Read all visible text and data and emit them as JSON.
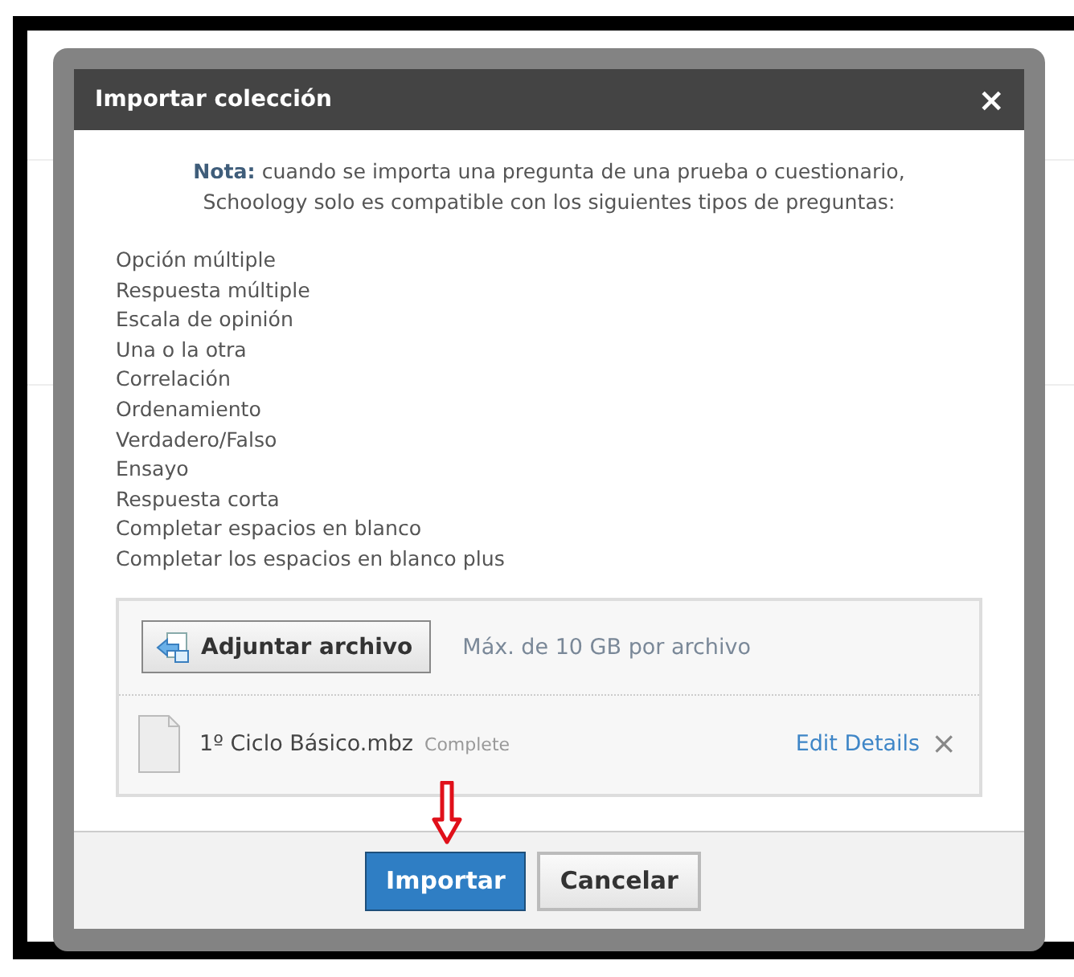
{
  "dialog": {
    "title": "Importar colección",
    "close": "×"
  },
  "note": "**Nota:** cuando se importa una pregunta de una prueba o cuestionario, Schoology solo es compatible con los siguientes tipos de preguntas:",
  "question_types": [
    "Opción múltiple",
    "Respuesta múltiple",
    "Escala de opinión",
    "Una o la otra",
    "Correlación",
    "Ordenamiento",
    "Verdadero/Falso",
    "Ensayo",
    "Respuesta corta",
    "Completar espacios en blanco",
    "Completar los espacios en blanco plus"
  ],
  "attach": {
    "button": "Adjuntar archivo",
    "limit": "Máx. de 10 GB por archivo"
  },
  "files": [
    {
      "name": "1º Ciclo Básico.mbz",
      "status": "Complete",
      "action": "Edit Details",
      "remove": "×"
    }
  ],
  "buttons": [
    {
      "label": "Importar",
      "kind": "primary"
    },
    {
      "label": "Cancelar",
      "kind": "secondary"
    }
  ]
}
